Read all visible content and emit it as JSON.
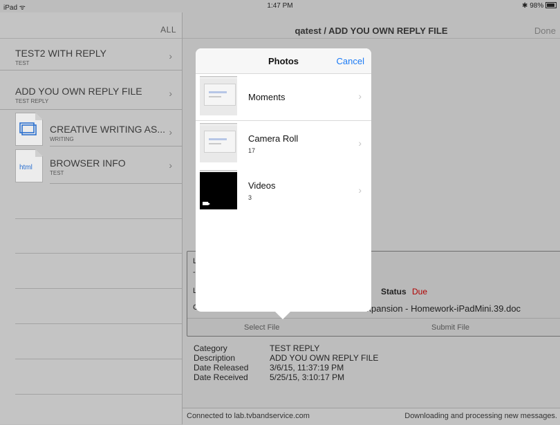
{
  "status_bar": {
    "device": "iPad",
    "time": "1:47 PM",
    "battery": "98%"
  },
  "sidebar": {
    "filter_label": "ALL",
    "items": [
      {
        "title": "TEST2 WITH REPLY",
        "subtitle": "TEST"
      },
      {
        "title": "ADD YOU OWN REPLY FILE",
        "subtitle": "TEST REPLY"
      },
      {
        "title": "CREATIVE WRITING AS...",
        "subtitle": "WRITING",
        "icon": "document-icon"
      },
      {
        "title": "BROWSER INFO",
        "subtitle": "TEST",
        "icon_label": "html"
      }
    ]
  },
  "navbar": {
    "title": "qatest / ADD YOU OWN REPLY FILE",
    "done_label": "Done"
  },
  "assignment_card": {
    "status_label": "Status",
    "status_value": "Due",
    "status_color": "#b00000",
    "filename": "d Expansion - Homework-iPadMini.39.doc",
    "select_file_label": "Select File",
    "submit_file_label": "Submit File",
    "partial_letters": [
      "L",
      "-",
      "L",
      "C"
    ]
  },
  "details": [
    {
      "key": "Category",
      "value": "TEST REPLY"
    },
    {
      "key": "Description",
      "value": "ADD YOU OWN REPLY FILE"
    },
    {
      "key": "Date Released",
      "value": "3/6/15, 11:37:19 PM"
    },
    {
      "key": "Date Received",
      "value": "5/25/15, 3:10:17 PM"
    }
  ],
  "footer": {
    "connection": "Connected to lab.tvbandservice.com",
    "activity": "Downloading and processing new messages."
  },
  "photos_popover": {
    "title": "Photos",
    "cancel_label": "Cancel",
    "cancel_color": "#1a7af5",
    "albums": [
      {
        "name": "Moments",
        "count": ""
      },
      {
        "name": "Camera Roll",
        "count": "17"
      },
      {
        "name": "Videos",
        "count": "3"
      }
    ]
  }
}
